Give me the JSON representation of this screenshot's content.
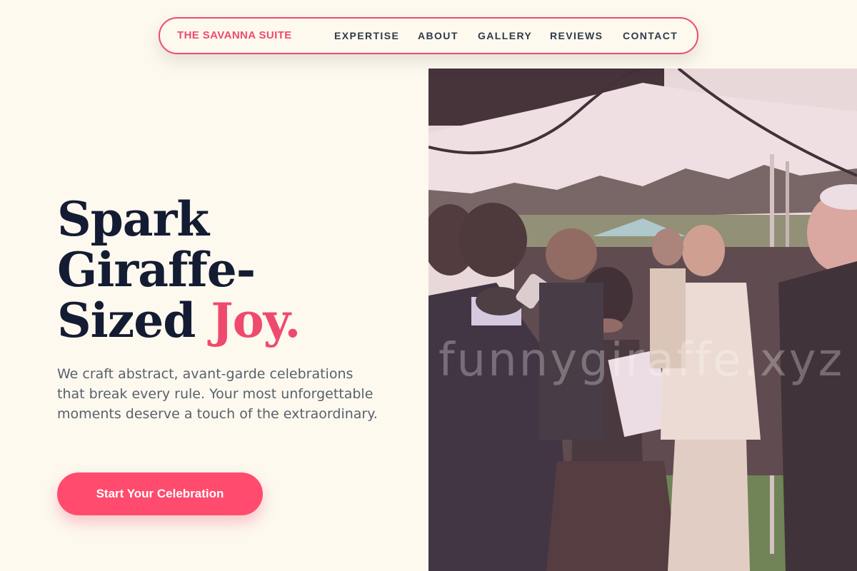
{
  "nav": {
    "brand": "THE SAVANNA SUITE",
    "links": [
      "EXPERTISE",
      "ABOUT",
      "GALLERY",
      "REVIEWS",
      "CONTACT"
    ]
  },
  "hero": {
    "title_line1": "Spark",
    "title_line2": "Giraffe-",
    "title_line3": "Sized",
    "title_accent": "Joy.",
    "description": "We craft abstract, avant-garde celebrations that break every rule. Your most unforgettable moments deserve a touch of the extraordinary.",
    "cta_label": "Start Your Celebration"
  },
  "photo": {
    "watermark": "funnygiraffe.xyz"
  },
  "colors": {
    "accent": "#ef4a6e",
    "background": "#fdf9ef",
    "heading": "#141c33",
    "body_text": "#59616d"
  }
}
